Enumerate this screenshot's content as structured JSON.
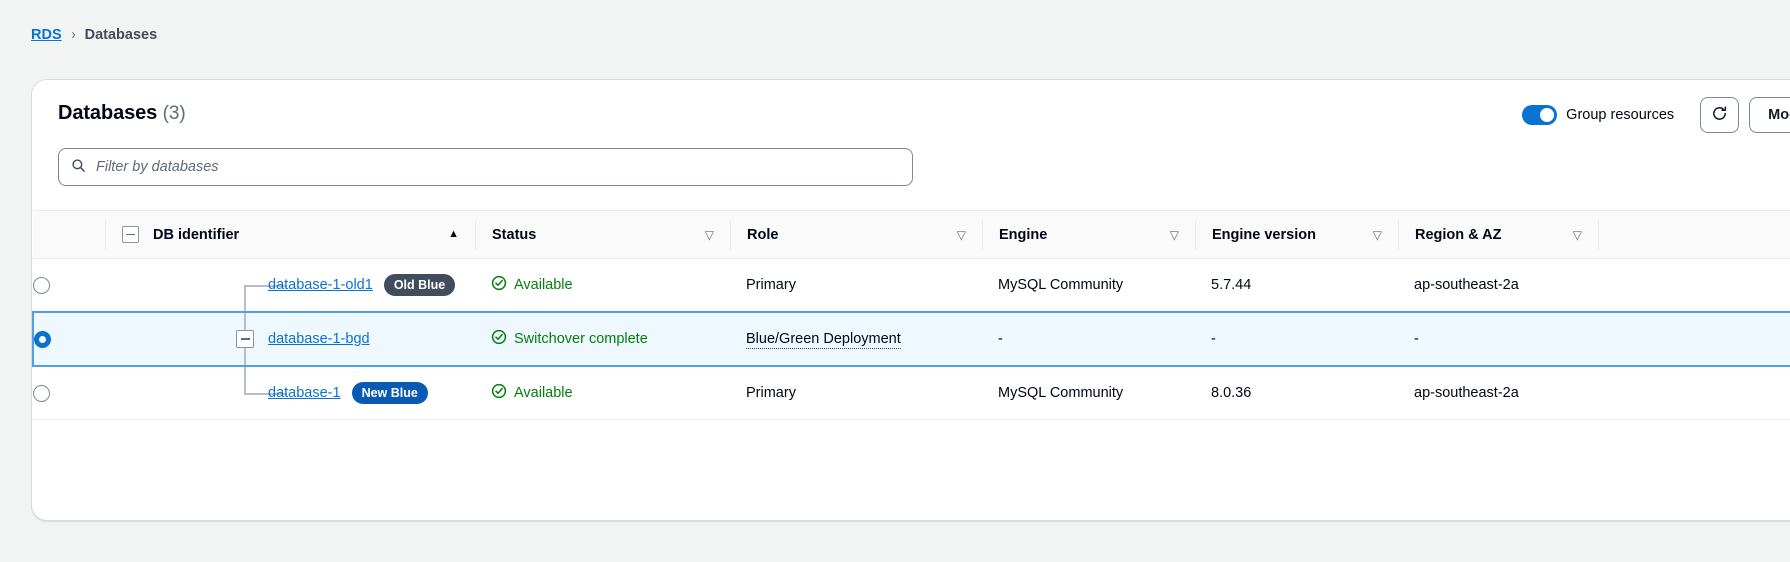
{
  "breadcrumb": {
    "root": "RDS",
    "separator": "›",
    "current": "Databases"
  },
  "card": {
    "title": "Databases",
    "count": "(3)",
    "toggle": {
      "label": "Group resources",
      "state": "on",
      "color": "#0972d3"
    },
    "refresh_icon": "refresh-icon",
    "modify_button": "Modi",
    "filter": {
      "icon": "search-icon",
      "placeholder": "Filter by databases",
      "value": ""
    }
  },
  "table": {
    "columns": [
      {
        "label": "DB identifier",
        "sort": "asc",
        "sort_glyph": "▲"
      },
      {
        "label": "Status",
        "sort": "none",
        "sort_glyph": "▽"
      },
      {
        "label": "Role",
        "sort": "none",
        "sort_glyph": "▽"
      },
      {
        "label": "Engine",
        "sort": "none",
        "sort_glyph": "▽"
      },
      {
        "label": "Engine version",
        "sort": "none",
        "sort_glyph": "▽"
      },
      {
        "label": "Region & AZ",
        "sort": "none",
        "sort_glyph": "▽"
      }
    ],
    "rows": [
      {
        "selected": "false",
        "identifier": "database-1-old1",
        "badge": "Old Blue",
        "badge_kind": "old",
        "status": "Available",
        "status_icon": "check-circle-icon",
        "role": "Primary",
        "role_tooltip": "false",
        "engine": "MySQL Community",
        "engine_version": "5.7.44",
        "region_az": "ap-southeast-2a"
      },
      {
        "selected": "true",
        "identifier": "database-1-bgd",
        "badge": "",
        "badge_kind": "",
        "status": "Switchover complete",
        "status_icon": "check-circle-icon",
        "role": "Blue/Green Deployment",
        "role_tooltip": "true",
        "engine": "-",
        "engine_version": "-",
        "region_az": "-"
      },
      {
        "selected": "false",
        "identifier": "database-1",
        "badge": "New Blue",
        "badge_kind": "new",
        "status": "Available",
        "status_icon": "check-circle-icon",
        "role": "Primary",
        "role_tooltip": "false",
        "engine": "MySQL Community",
        "engine_version": "8.0.36",
        "region_az": "ap-southeast-2a"
      }
    ]
  },
  "colors": {
    "link": "#0972d3",
    "success": "#037f0c",
    "badge_old": "#414d5c",
    "badge_new": "#0a5ab5",
    "selected_row_bg": "#f0f8ff",
    "selected_row_border": "#539fe5"
  }
}
